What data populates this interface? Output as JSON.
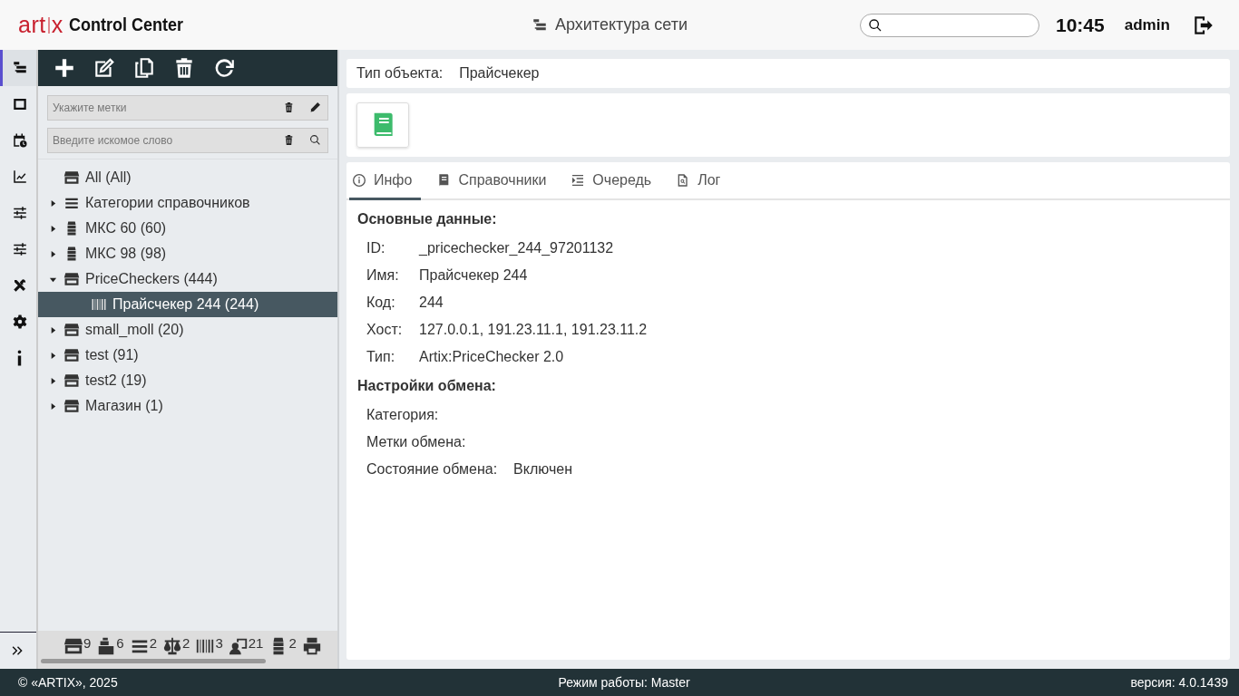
{
  "header": {
    "logo": "art",
    "logo_x": "x",
    "app_name": "Control Center",
    "page_title": "Архитектура сети",
    "time": "10:45",
    "user": "admin"
  },
  "rail": [
    {
      "kind": "tree",
      "selected": true
    },
    {
      "kind": "frame",
      "selected": false
    },
    {
      "kind": "calendar",
      "selected": false
    },
    {
      "kind": "chart",
      "selected": false
    },
    {
      "kind": "sliders",
      "selected": false
    },
    {
      "kind": "sliders",
      "selected": false
    },
    {
      "kind": "tools",
      "selected": false
    },
    {
      "kind": "gear",
      "selected": false
    },
    {
      "kind": "info",
      "selected": false
    }
  ],
  "toolbar": [
    {
      "kind": "add"
    },
    {
      "kind": "edit"
    },
    {
      "kind": "copy"
    },
    {
      "kind": "delete"
    },
    {
      "kind": "refresh"
    }
  ],
  "filters": [
    {
      "placeholder": "Укажите метки",
      "kind": "edit"
    },
    {
      "placeholder": "Введите искомое слово",
      "kind": "search"
    }
  ],
  "tree": [
    {
      "label": "All (All)",
      "kind": "store",
      "selected": false
    },
    {
      "label": "Категории справочников",
      "kind": "list",
      "expanded": false,
      "selected": false
    },
    {
      "label": "МКС 60 (60)",
      "kind": "server",
      "expanded": false,
      "selected": false
    },
    {
      "label": "МКС 98 (98)",
      "kind": "server",
      "expanded": false,
      "selected": false
    },
    {
      "label": "PriceCheckers (444)",
      "kind": "store",
      "expanded": true,
      "selected": false,
      "children": [
        {
          "label": "Прайсчекер 244 (244)",
          "kind": "barcode",
          "selected": true
        }
      ]
    },
    {
      "label": "small_moll (20)",
      "kind": "store",
      "expanded": false,
      "selected": false
    },
    {
      "label": "test (91)",
      "kind": "store",
      "expanded": false,
      "selected": false
    },
    {
      "label": "test2 (19)",
      "kind": "store",
      "expanded": false,
      "selected": false
    },
    {
      "label": "Магазин (1)",
      "kind": "store",
      "expanded": false,
      "selected": false
    }
  ],
  "counters": [
    {
      "kind": "store",
      "count": "9"
    },
    {
      "kind": "register",
      "count": "6"
    },
    {
      "kind": "list",
      "count": "2"
    },
    {
      "kind": "scales",
      "count": "2"
    },
    {
      "kind": "barcode",
      "count": "3"
    },
    {
      "kind": "user",
      "count": "21"
    },
    {
      "kind": "server",
      "count": "2"
    },
    {
      "kind": "printer"
    }
  ],
  "object_type": {
    "label": "Тип объекта:",
    "value": "Прайсчекер"
  },
  "tabs": [
    {
      "label": "Инфо",
      "kind": "info",
      "selected": true
    },
    {
      "label": "Справочники",
      "kind": "book",
      "selected": false
    },
    {
      "label": "Очередь",
      "kind": "queue",
      "selected": false
    },
    {
      "label": "Лог",
      "kind": "log",
      "selected": false
    }
  ],
  "sections": [
    {
      "title": "Основные данные:",
      "fields": [
        {
          "label": "ID:",
          "value": "_pricechecker_244_97201132"
        },
        {
          "label": "Имя:",
          "value": "Прайсчекер 244"
        },
        {
          "label": "Код:",
          "value": "244"
        },
        {
          "label": "Хост:",
          "value": "127.0.0.1, 191.23.11.1, 191.23.11.2"
        },
        {
          "label": "Тип:",
          "value": "Artix:PriceChecker 2.0"
        }
      ]
    },
    {
      "title": "Настройки обмена:",
      "fields": [
        {
          "label": "Категория:"
        },
        {
          "label": "Метки обмена:"
        },
        {
          "label": "Состояние обмена:",
          "value": "Включен"
        }
      ]
    }
  ],
  "footer": {
    "copyright": "© «ARTIX», 2025",
    "mode": "Режим работы: Master",
    "version": "версия: 4.0.1439"
  }
}
